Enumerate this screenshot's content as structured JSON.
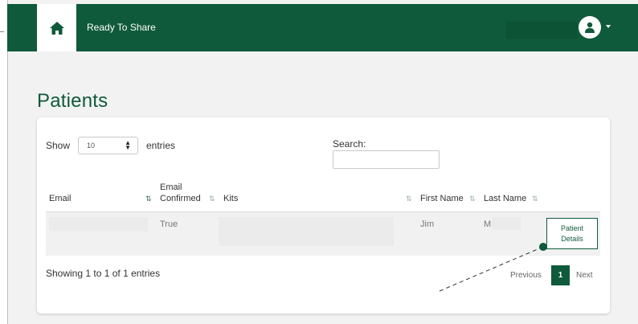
{
  "header": {
    "home_icon": "home-icon",
    "brand": "Ready To Share",
    "user_icon": "user-icon",
    "caret_icon": "caret-down-icon",
    "bg_color": "#0f5a3a"
  },
  "page": {
    "title": "Patients"
  },
  "table_controls": {
    "show_label": "Show",
    "entries_value": "10",
    "entries_label": "entries",
    "search_label": "Search:",
    "search_value": ""
  },
  "columns": [
    {
      "line1": "",
      "line2": "Email"
    },
    {
      "line1": "Email",
      "line2": "Confirmed"
    },
    {
      "line1": "",
      "line2": "Kits"
    },
    {
      "line1": "",
      "line2": "First Name"
    },
    {
      "line1": "",
      "line2": "Last Name"
    }
  ],
  "rows": [
    {
      "email": "",
      "email_confirmed": "True",
      "kits": "",
      "first_name": "Jim",
      "last_name": "M",
      "action": "Patient Details"
    }
  ],
  "footer": {
    "info": "Showing 1 to 1 of 1 entries",
    "previous": "Previous",
    "current_page": "1",
    "next": "Next"
  },
  "colors": {
    "accent": "#0f5a3a",
    "page_bg": "#f2f2f2"
  }
}
